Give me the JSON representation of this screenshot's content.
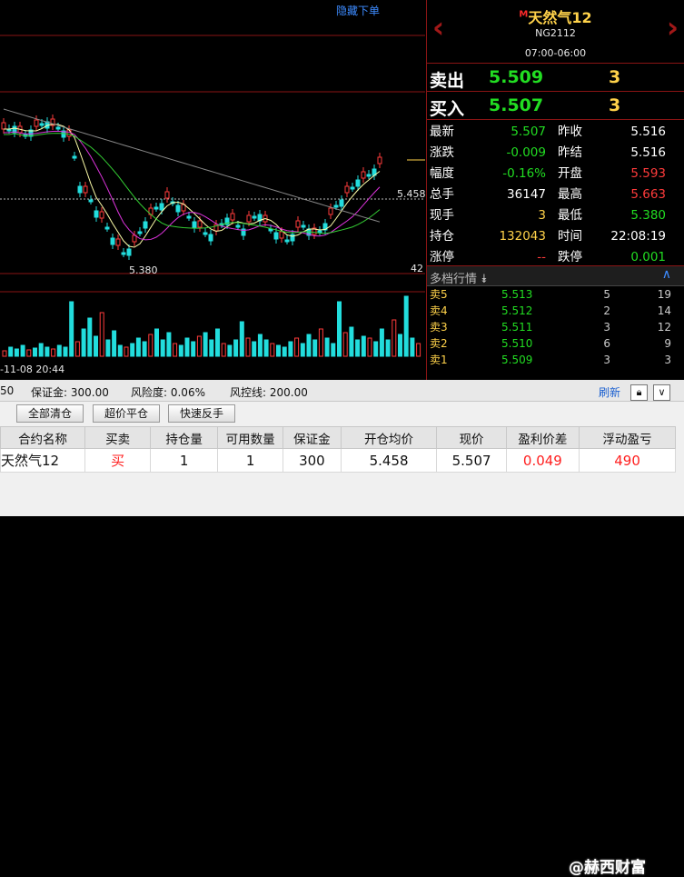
{
  "chart": {
    "hide_link": "隐藏下单",
    "low_label": "5.380",
    "avg_label": "5.458",
    "vol_label": "42",
    "date_label": "-11-08 20:44"
  },
  "instrument": {
    "marker": "M",
    "name": "天然气12",
    "code": "NG2112",
    "session": "07:00-06:00"
  },
  "sell": {
    "label": "卖出",
    "price": "5.509",
    "qty": "3"
  },
  "buy": {
    "label": "买入",
    "price": "5.507",
    "qty": "3"
  },
  "quote": [
    {
      "k1": "最新",
      "v1": "5.507",
      "c1": "#22dd22",
      "k2": "昨收",
      "v2": "5.516",
      "c2": "#ffffff"
    },
    {
      "k1": "涨跌",
      "v1": "-0.009",
      "c1": "#22dd22",
      "k2": "昨结",
      "v2": "5.516",
      "c2": "#ffffff"
    },
    {
      "k1": "幅度",
      "v1": "-0.16%",
      "c1": "#22dd22",
      "k2": "开盘",
      "v2": "5.593",
      "c2": "#ff3b3b"
    },
    {
      "k1": "总手",
      "v1": "36147",
      "c1": "#ffffff",
      "k2": "最高",
      "v2": "5.663",
      "c2": "#ff3b3b"
    },
    {
      "k1": "现手",
      "v1": "3",
      "c1": "#ffd24a",
      "k2": "最低",
      "v2": "5.380",
      "c2": "#22dd22"
    },
    {
      "k1": "持仓",
      "v1": "132043",
      "c1": "#ffd24a",
      "k2": "时间",
      "v2": "22:08:19",
      "c2": "#ffffff"
    },
    {
      "k1": "涨停",
      "v1": "--",
      "c1": "#ff3b3b",
      "k2": "跌停",
      "v2": "0.001",
      "c2": "#22dd22"
    }
  ],
  "depth": {
    "title": "多档行情",
    "rows": [
      {
        "label": "卖5",
        "price": "5.513",
        "qty": "5",
        "total": "19"
      },
      {
        "label": "卖4",
        "price": "5.512",
        "qty": "2",
        "total": "14"
      },
      {
        "label": "卖3",
        "price": "5.511",
        "qty": "3",
        "total": "12"
      },
      {
        "label": "卖2",
        "price": "5.510",
        "qty": "6",
        "total": "9"
      },
      {
        "label": "卖1",
        "price": "5.509",
        "qty": "3",
        "total": "3"
      }
    ]
  },
  "status": {
    "left": "50",
    "margin": "保证金: 300.00",
    "risk": "风险度: 0.06%",
    "risk_line": "风控线: 200.00",
    "refresh": "刷新"
  },
  "buttons": {
    "close_all": "全部清仓",
    "close_flat": "超价平仓",
    "reverse": "快速反手"
  },
  "table": {
    "headers": [
      "合约名称",
      "买卖",
      "持仓量",
      "可用数量",
      "保证金",
      "开仓均价",
      "现价",
      "盈利价差",
      "浮动盈亏"
    ],
    "row": [
      "天然气12",
      "买",
      "1",
      "1",
      "300",
      "5.458",
      "5.507",
      "0.049",
      "490"
    ]
  },
  "watermark": "@赫西财富",
  "colors": {
    "up": "#ff3b3b",
    "down": "#22dd22",
    "gold": "#ffd24a",
    "border": "#8a1414"
  }
}
